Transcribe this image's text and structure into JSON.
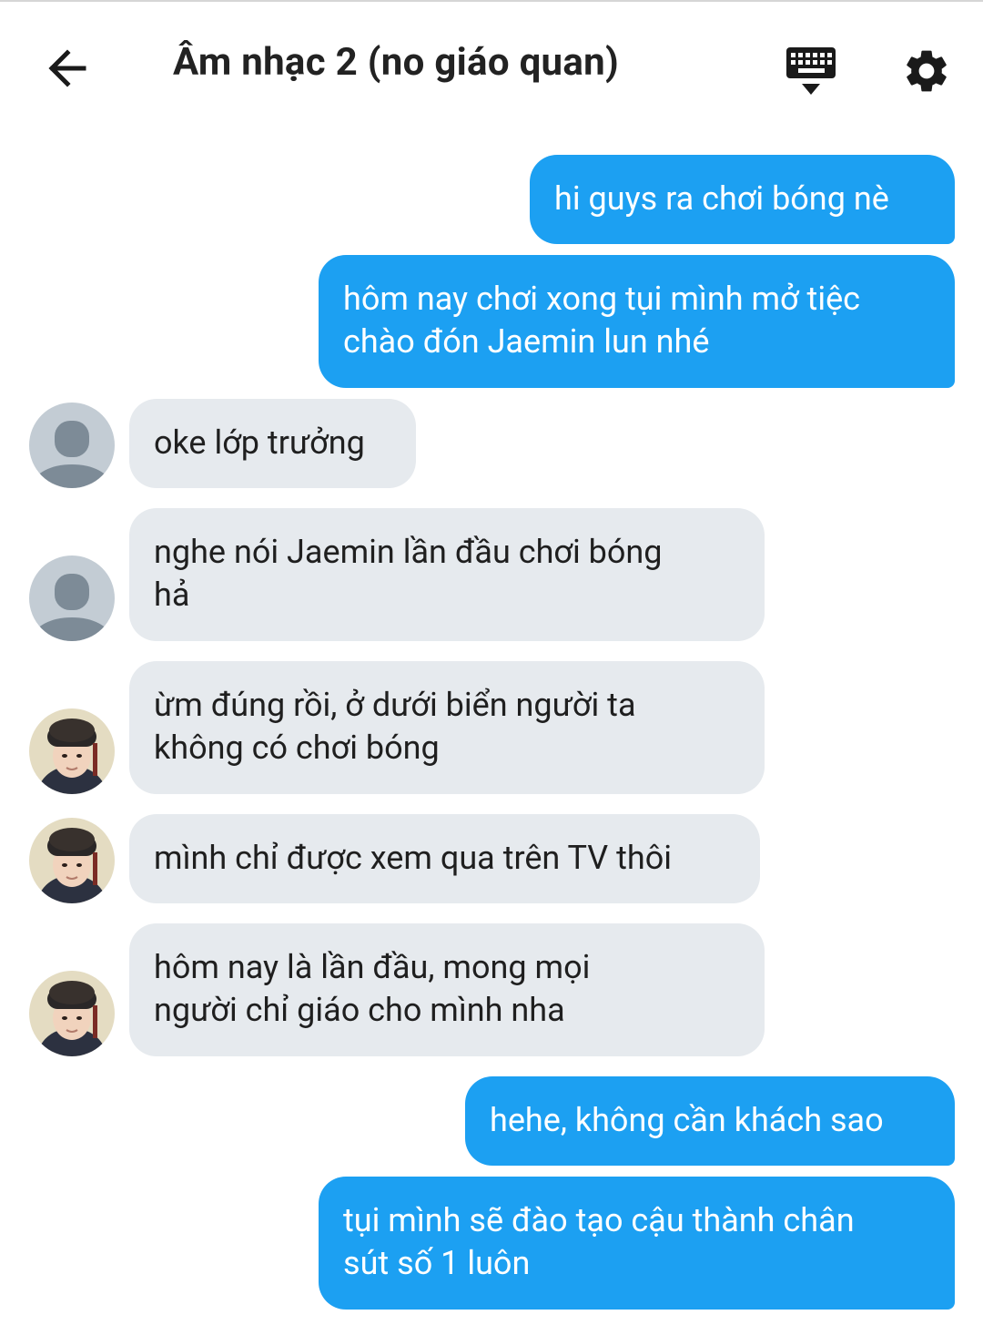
{
  "header": {
    "title": "Âm nhạc 2 (no giáo quan)",
    "back_icon": "arrow-left-icon",
    "keyboard_icon": "keyboard-icon",
    "settings_icon": "gear-icon"
  },
  "colors": {
    "outgoing": "#1ca0f2",
    "incoming": "#e6eaee",
    "default_avatar_bg": "#c3ccd4",
    "default_avatar_fg": "#7d8b97"
  },
  "messages": [
    {
      "sender": "me",
      "text": "hi guys ra chơi bóng nè"
    },
    {
      "sender": "me",
      "text": "hôm nay chơi xong tụi mình mở tiệc\nchào đón Jaemin lun nhé"
    },
    {
      "sender": "other",
      "avatar": "default-avatar",
      "text": "oke lớp trưởng"
    },
    {
      "sender": "other",
      "avatar": "default-avatar",
      "text": "nghe nói Jaemin lần đầu chơi bóng\nhả"
    },
    {
      "sender": "other",
      "avatar": "photo-avatar",
      "text": "ừm đúng rồi, ở dưới biển người ta\nkhông có chơi bóng"
    },
    {
      "sender": "other",
      "avatar": "photo-avatar",
      "text": "mình chỉ được xem qua trên TV thôi"
    },
    {
      "sender": "other",
      "avatar": "photo-avatar",
      "text": "hôm nay là lần đầu, mong mọi\nngười chỉ giáo cho mình nha"
    },
    {
      "sender": "me",
      "text": "hehe, không cần khách sao"
    },
    {
      "sender": "me",
      "text": "tụi mình sẽ đào tạo cậu thành chân\nsút số 1 luôn"
    }
  ]
}
